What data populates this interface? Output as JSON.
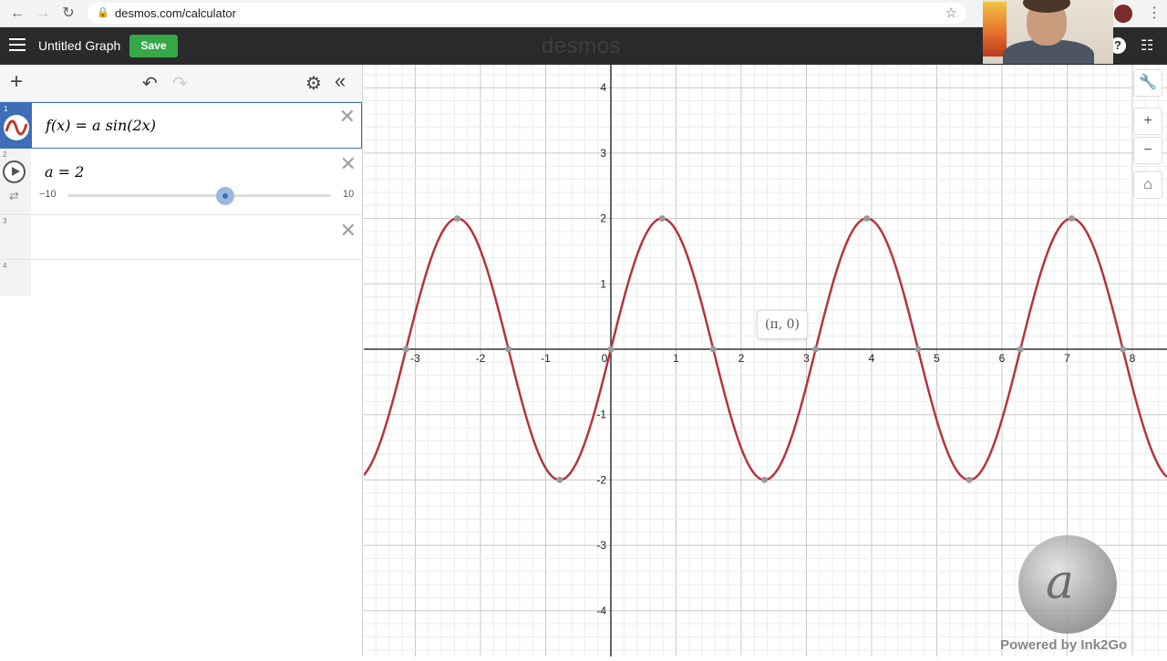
{
  "browser": {
    "url": "desmos.com/calculator",
    "back_icon": "arrow-left-icon",
    "forward_icon": "arrow-right-icon",
    "reload_icon": "reload-icon"
  },
  "header": {
    "title": "Untitled Graph",
    "save_label": "Save",
    "logo": "desmos",
    "help_label": "?",
    "accent": "#36a847"
  },
  "expressions": [
    {
      "num": "1",
      "latex": "f(x) = a sin(2x)",
      "color": "#c0392b"
    },
    {
      "num": "2",
      "latex": "a = 2",
      "slider": {
        "min": "−10",
        "max": "10",
        "value": 2
      }
    },
    {
      "num": "3",
      "latex": ""
    },
    {
      "num": "4",
      "latex": ""
    }
  ],
  "graph": {
    "x_range": [
      -3.7,
      8.6
    ],
    "y_range": [
      -4.5,
      4.5
    ],
    "x_ticks": [
      "-3",
      "-2",
      "-1",
      "0",
      "1",
      "2",
      "3",
      "4",
      "5",
      "6",
      "7",
      "8"
    ],
    "y_ticks": [
      "4",
      "3",
      "2",
      "1",
      "-1",
      "-2",
      "-3",
      "-4"
    ],
    "curve_color": "#b5343e",
    "point_label": "(π, 0)"
  },
  "watermark": {
    "text": "Powered by Ink2Go"
  }
}
